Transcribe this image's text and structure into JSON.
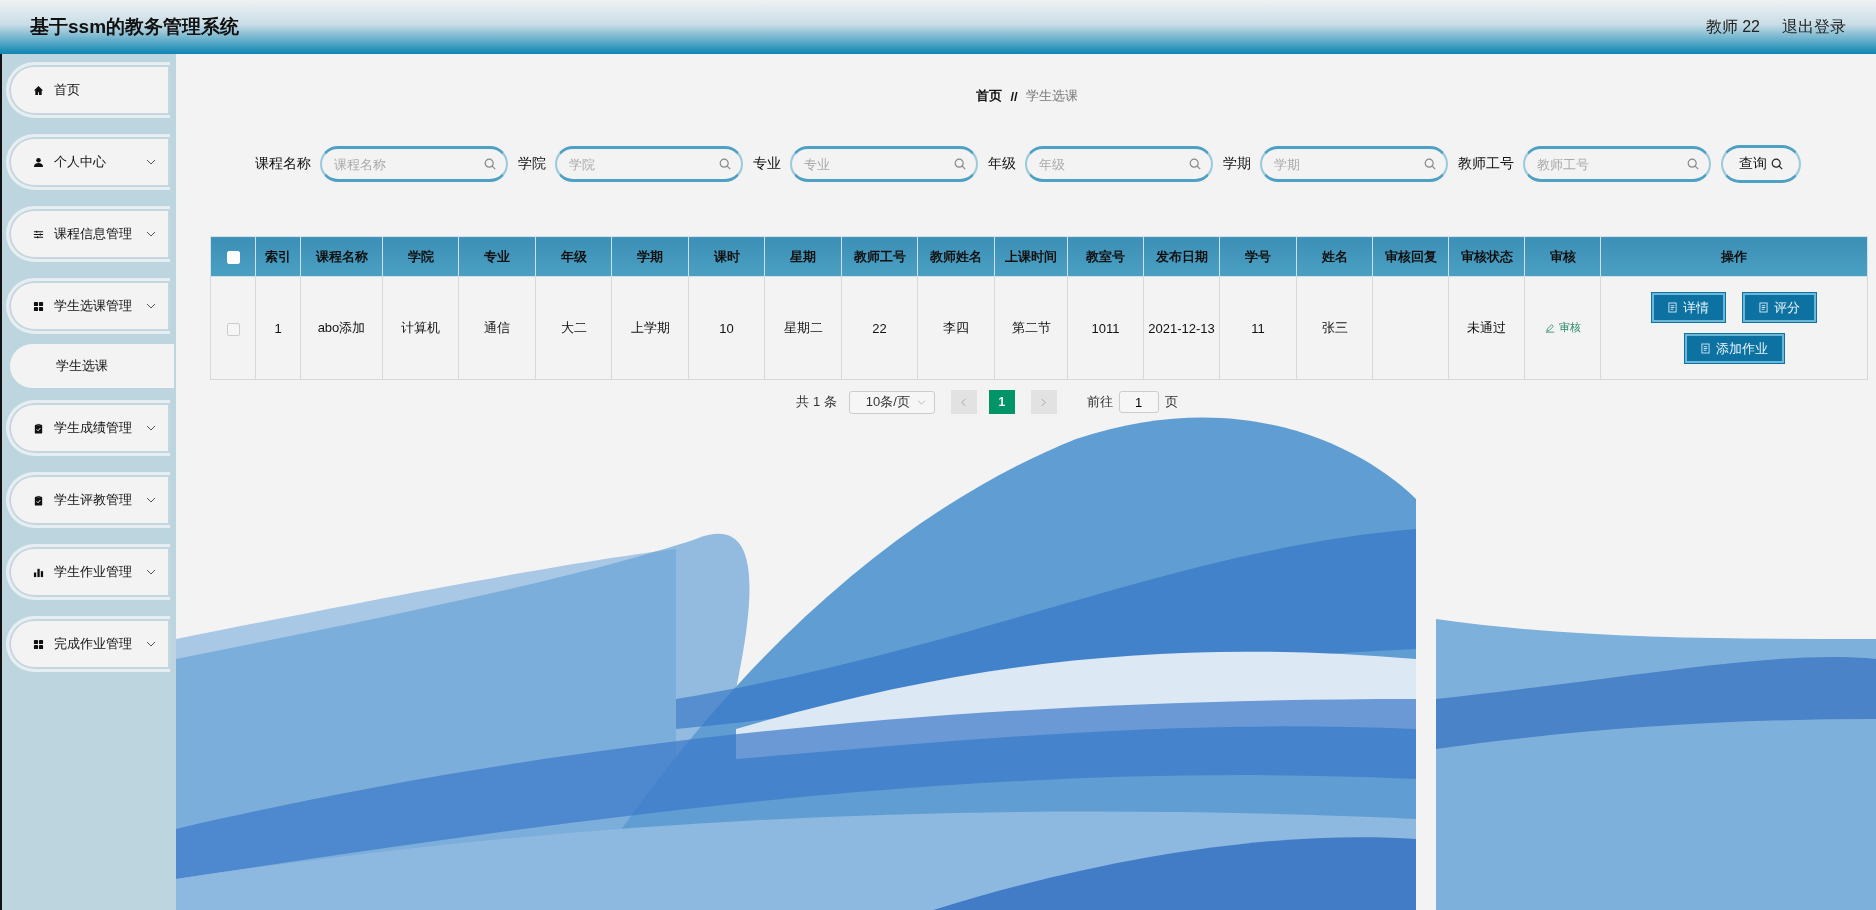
{
  "header": {
    "title": "基于ssm的教务管理系统",
    "user": "教师 22",
    "logout": "退出登录"
  },
  "sidebar": {
    "items": [
      {
        "label": "首页",
        "expandable": false
      },
      {
        "label": "个人中心",
        "expandable": true
      },
      {
        "label": "课程信息管理",
        "expandable": true
      },
      {
        "label": "学生选课管理",
        "expandable": true,
        "children": [
          {
            "label": "学生选课",
            "selected": true
          }
        ]
      },
      {
        "label": "学生成绩管理",
        "expandable": true
      },
      {
        "label": "学生评教管理",
        "expandable": true
      },
      {
        "label": "学生作业管理",
        "expandable": true
      },
      {
        "label": "完成作业管理",
        "expandable": true
      }
    ]
  },
  "breadcrumb": {
    "home": "首页",
    "separator": "//",
    "current": "学生选课"
  },
  "search": {
    "fields": [
      {
        "label": "课程名称",
        "placeholder": "课程名称"
      },
      {
        "label": "学院",
        "placeholder": "学院"
      },
      {
        "label": "专业",
        "placeholder": "专业"
      },
      {
        "label": "年级",
        "placeholder": "年级"
      },
      {
        "label": "学期",
        "placeholder": "学期"
      },
      {
        "label": "教师工号",
        "placeholder": "教师工号"
      }
    ],
    "button": "查询"
  },
  "table": {
    "select_all_checked": false,
    "columns": [
      "索引",
      "课程名称",
      "学院",
      "专业",
      "年级",
      "学期",
      "课时",
      "星期",
      "教师工号",
      "教师姓名",
      "上课时间",
      "教室号",
      "发布日期",
      "学号",
      "姓名",
      "审核回复",
      "审核状态",
      "审核",
      "操作"
    ],
    "rows": [
      {
        "checked": false,
        "cells": [
          "1",
          "abo添加",
          "计算机",
          "通信",
          "大二",
          "上学期",
          "10",
          "星期二",
          "22",
          "李四",
          "第二节",
          "1011",
          "2021-12-13",
          "11",
          "张三",
          null,
          "未通过"
        ],
        "review_link": "审核",
        "actions": [
          "详情",
          "评分",
          "添加作业"
        ]
      }
    ]
  },
  "pagination": {
    "total": "共 1 条",
    "page_size": "10条/页",
    "pages": [
      {
        "label": "1",
        "selected": true
      }
    ],
    "goto_label": "前往",
    "goto_value": "1",
    "goto_suffix": "页"
  }
}
